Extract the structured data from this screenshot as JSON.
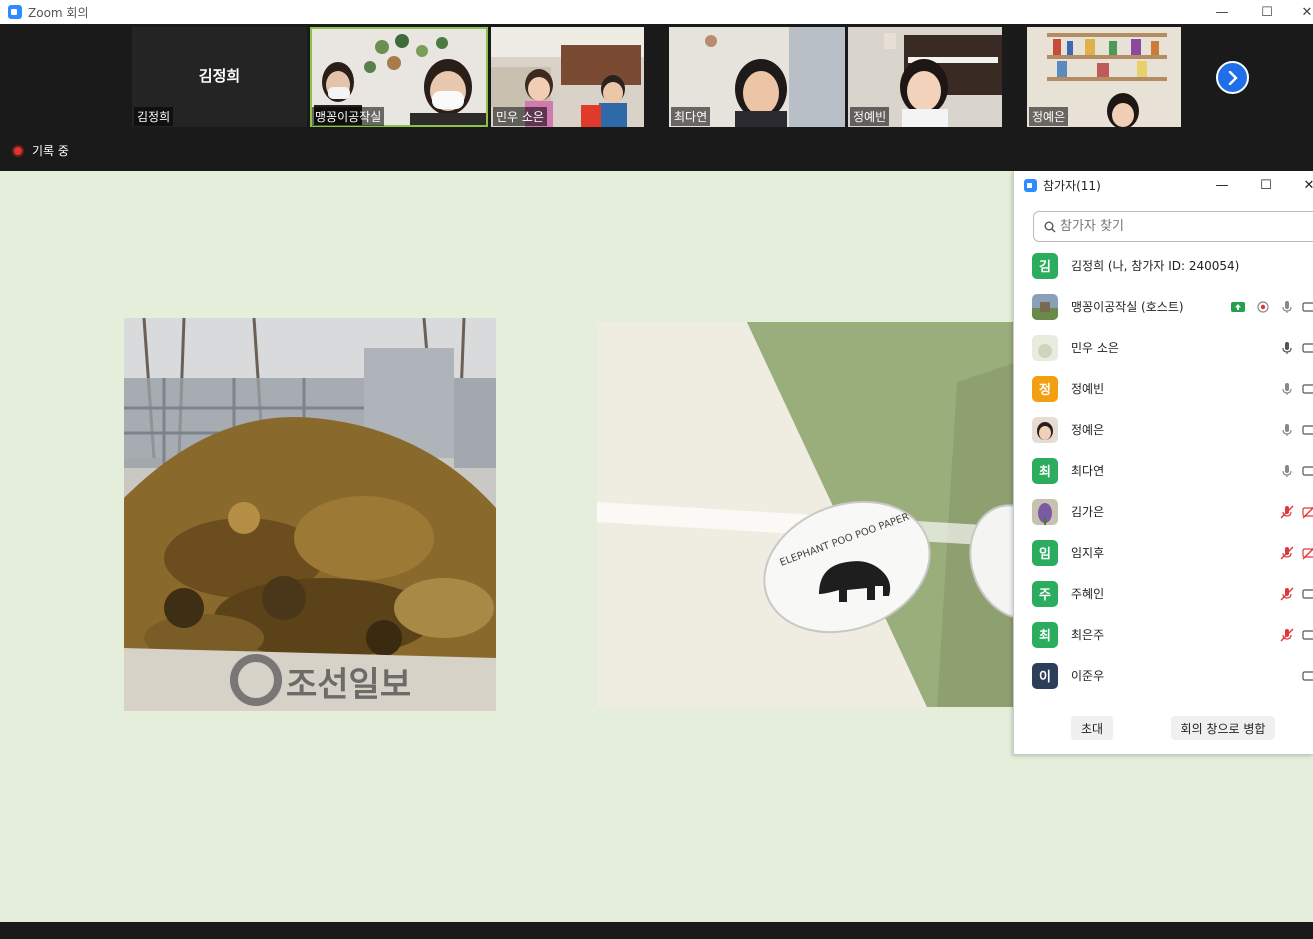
{
  "window": {
    "title": "Zoom 회의",
    "minimize": "—",
    "maximize": "☐",
    "close": "✕"
  },
  "strip": {
    "tiles": [
      {
        "name": "김정희",
        "big": "김정희"
      },
      {
        "name": "맹꽁이공작실"
      },
      {
        "name": "민우 소은"
      },
      {
        "name": "최다연"
      },
      {
        "name": "정예빈"
      },
      {
        "name": "정예은"
      }
    ],
    "recording": "기록 중"
  },
  "panel": {
    "title": "참가자(11)",
    "minimize": "—",
    "maximize": "☐",
    "close": "✕",
    "search_placeholder": "참가자 찾기",
    "participants": [
      {
        "name": "김정희 (나, 참가자 ID: 240054)",
        "initial": "김",
        "color": "#2bac5e"
      },
      {
        "name": "맹꽁이공작실 (호스트)",
        "initial": "",
        "color": "#7a9a6a"
      },
      {
        "name": "민우 소은",
        "initial": "",
        "color": "#dfe4d8"
      },
      {
        "name": "정예빈",
        "initial": "정",
        "color": "#f2a011"
      },
      {
        "name": "정예은",
        "initial": "",
        "color": "#c9a890"
      },
      {
        "name": "최다연",
        "initial": "최",
        "color": "#2bac5e"
      },
      {
        "name": "김가은",
        "initial": "",
        "color": "#7a5aa0"
      },
      {
        "name": "임지후",
        "initial": "임",
        "color": "#2bac5e"
      },
      {
        "name": "주혜인",
        "initial": "주",
        "color": "#2bac5e"
      },
      {
        "name": "최은주",
        "initial": "최",
        "color": "#2bac5e"
      },
      {
        "name": "이준우",
        "initial": "이",
        "color": "#2c3e58"
      }
    ],
    "invite_label": "초대",
    "merge_label": "회의 창으로 병합"
  },
  "share": {
    "watermark": "조선일보",
    "label_text": "ELEPHANT POO POO PAPER"
  }
}
